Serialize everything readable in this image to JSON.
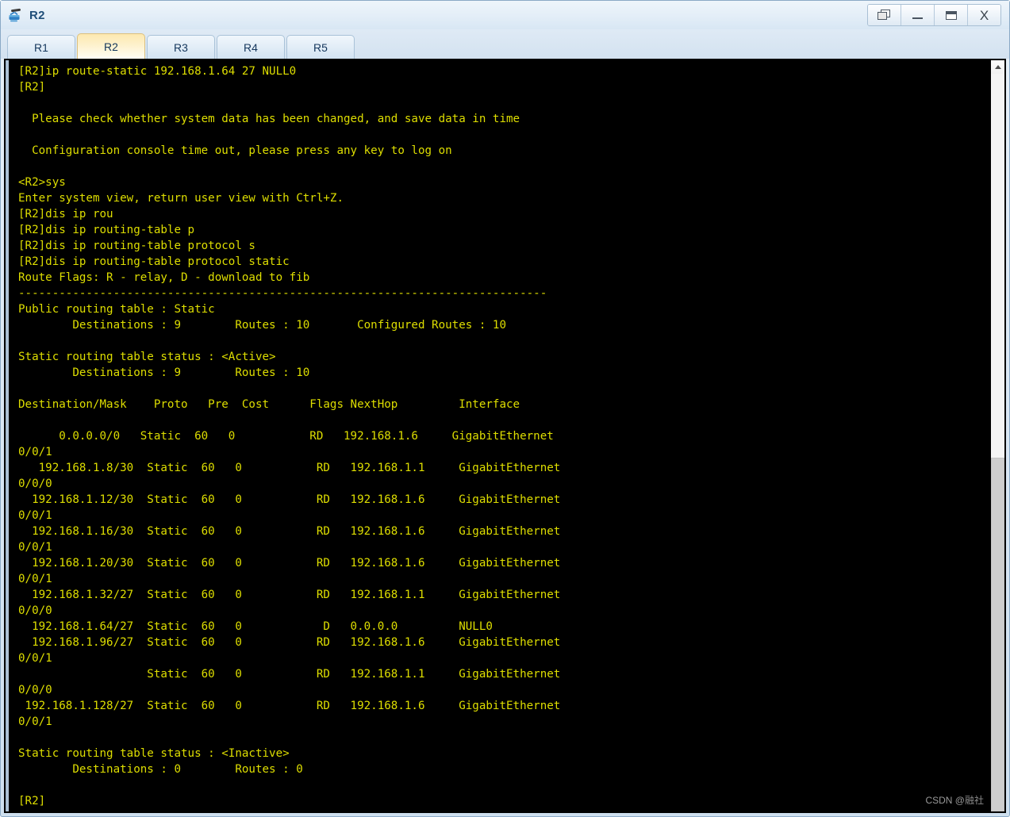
{
  "window": {
    "title": "R2",
    "icon": "router-icon",
    "controls": [
      {
        "name": "restore-button",
        "label": "Restore",
        "glyph": "restore-icon"
      },
      {
        "name": "minimize-button",
        "label": "Minimize",
        "glyph": "minimize-icon"
      },
      {
        "name": "maximize-button",
        "label": "Maximize",
        "glyph": "maximize-icon"
      },
      {
        "name": "close-button",
        "label": "X",
        "glyph": "close-icon"
      }
    ]
  },
  "tabs": {
    "active": "R2",
    "items": [
      {
        "label": "R1"
      },
      {
        "label": "R2"
      },
      {
        "label": "R3"
      },
      {
        "label": "R4"
      },
      {
        "label": "R5"
      }
    ]
  },
  "terminal": {
    "foreground": "#dede00",
    "background": "#000000",
    "prompt_system": "[R2]",
    "prompt_user": "<R2>",
    "lines": [
      "[R2]ip route-static 192.168.1.64 27 NULL0",
      "[R2]",
      "",
      "  Please check whether system data has been changed, and save data in time",
      "",
      "  Configuration console time out, please press any key to log on",
      "",
      "<R2>sys",
      "Enter system view, return user view with Ctrl+Z.",
      "[R2]dis ip rou",
      "[R2]dis ip routing-table p",
      "[R2]dis ip routing-table protocol s",
      "[R2]dis ip routing-table protocol static",
      "Route Flags: R - relay, D - download to fib",
      "------------------------------------------------------------------------------",
      "Public routing table : Static",
      "        Destinations : 9        Routes : 10       Configured Routes : 10",
      "",
      "Static routing table status : <Active>",
      "        Destinations : 9        Routes : 10",
      "",
      "Destination/Mask    Proto   Pre  Cost      Flags NextHop         Interface",
      "",
      "      0.0.0.0/0   Static  60   0           RD   192.168.1.6     GigabitEthernet",
      "0/0/1",
      "   192.168.1.8/30  Static  60   0           RD   192.168.1.1     GigabitEthernet",
      "0/0/0",
      "  192.168.1.12/30  Static  60   0           RD   192.168.1.6     GigabitEthernet",
      "0/0/1",
      "  192.168.1.16/30  Static  60   0           RD   192.168.1.6     GigabitEthernet",
      "0/0/1",
      "  192.168.1.20/30  Static  60   0           RD   192.168.1.6     GigabitEthernet",
      "0/0/1",
      "  192.168.1.32/27  Static  60   0           RD   192.168.1.1     GigabitEthernet",
      "0/0/0",
      "  192.168.1.64/27  Static  60   0            D   0.0.0.0         NULL0",
      "  192.168.1.96/27  Static  60   0           RD   192.168.1.6     GigabitEthernet",
      "0/0/1",
      "                   Static  60   0           RD   192.168.1.1     GigabitEthernet",
      "0/0/0",
      " 192.168.1.128/27  Static  60   0           RD   192.168.1.6     GigabitEthernet",
      "0/0/1",
      "",
      "Static routing table status : <Inactive>",
      "        Destinations : 0        Routes : 0",
      "",
      "[R2]"
    ],
    "routing_table": {
      "columns": [
        "Destination/Mask",
        "Proto",
        "Pre",
        "Cost",
        "Flags",
        "NextHop",
        "Interface"
      ],
      "rows": [
        {
          "destination": "0.0.0.0/0",
          "proto": "Static",
          "pre": "60",
          "cost": "0",
          "flags": "RD",
          "nexthop": "192.168.1.6",
          "interface": "GigabitEthernet0/0/1"
        },
        {
          "destination": "192.168.1.8/30",
          "proto": "Static",
          "pre": "60",
          "cost": "0",
          "flags": "RD",
          "nexthop": "192.168.1.1",
          "interface": "GigabitEthernet0/0/0"
        },
        {
          "destination": "192.168.1.12/30",
          "proto": "Static",
          "pre": "60",
          "cost": "0",
          "flags": "RD",
          "nexthop": "192.168.1.6",
          "interface": "GigabitEthernet0/0/1"
        },
        {
          "destination": "192.168.1.16/30",
          "proto": "Static",
          "pre": "60",
          "cost": "0",
          "flags": "RD",
          "nexthop": "192.168.1.6",
          "interface": "GigabitEthernet0/0/1"
        },
        {
          "destination": "192.168.1.20/30",
          "proto": "Static",
          "pre": "60",
          "cost": "0",
          "flags": "RD",
          "nexthop": "192.168.1.6",
          "interface": "GigabitEthernet0/0/1"
        },
        {
          "destination": "192.168.1.32/27",
          "proto": "Static",
          "pre": "60",
          "cost": "0",
          "flags": "RD",
          "nexthop": "192.168.1.1",
          "interface": "GigabitEthernet0/0/0"
        },
        {
          "destination": "192.168.1.64/27",
          "proto": "Static",
          "pre": "60",
          "cost": "0",
          "flags": "D",
          "nexthop": "0.0.0.0",
          "interface": "NULL0"
        },
        {
          "destination": "192.168.1.96/27",
          "proto": "Static",
          "pre": "60",
          "cost": "0",
          "flags": "RD",
          "nexthop": "192.168.1.6",
          "interface": "GigabitEthernet0/0/1"
        },
        {
          "destination": "",
          "proto": "Static",
          "pre": "60",
          "cost": "0",
          "flags": "RD",
          "nexthop": "192.168.1.1",
          "interface": "GigabitEthernet0/0/0"
        },
        {
          "destination": "192.168.1.128/27",
          "proto": "Static",
          "pre": "60",
          "cost": "0",
          "flags": "RD",
          "nexthop": "192.168.1.6",
          "interface": "GigabitEthernet0/0/1"
        }
      ],
      "public_table_name": "Static",
      "destinations": "9",
      "routes": "10",
      "configured_routes": "10",
      "active_status": "<Active>",
      "active_destinations": "9",
      "active_routes": "10",
      "inactive_status": "<Inactive>",
      "inactive_destinations": "0",
      "inactive_routes": "0",
      "route_flags": "Route Flags: R - relay, D - download to fib"
    }
  },
  "scrollbar": {
    "up_arrow": "chevron-up-icon",
    "thumb_position_pct": 52
  },
  "watermark": {
    "prefix": "CSDN @",
    "author": "融社"
  }
}
